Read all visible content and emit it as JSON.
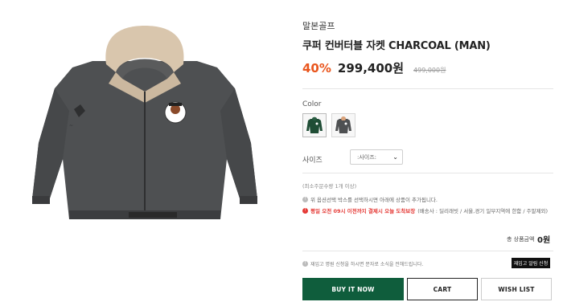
{
  "product": {
    "brand": "말본골프",
    "title": "쿠퍼 컨버터블 자켓 CHARCOAL (MAN)",
    "discount": "40%",
    "price": "299,400원",
    "original_price": "499,000원"
  },
  "options": {
    "color_label": "Color",
    "size_label": "사이즈",
    "size_placeholder": ":사이즈:"
  },
  "notices": {
    "min_order": "(최소주문수량 1개 이상)",
    "line1": "위 옵션선택 박스를 선택하시면 아래에 상품이 추가됩니다.",
    "line2_prefix": "평일 오전 09시 이전까지 결제시 오늘 도착보장",
    "line2_suffix": "(배송사 : 딜리래빗 / 서울,경기 일부지역에 한함 / 주말제외)"
  },
  "total": {
    "label": "총 상품금액",
    "value": "0원"
  },
  "restock": {
    "message": "재입고 명원 신청을 하시면 문자로 소식을 전해드립니다.",
    "button": "재입고 알림 신청"
  },
  "actions": {
    "buy": "BUY IT NOW",
    "cart": "CART",
    "wish": "WISH LIST"
  },
  "colors": {
    "charcoal": "#4e5052",
    "beige_hood": "#d9c6ad",
    "green_swatch": "#1f4d35",
    "buy_button": "#0f5d3c",
    "discount": "#e9561e"
  }
}
